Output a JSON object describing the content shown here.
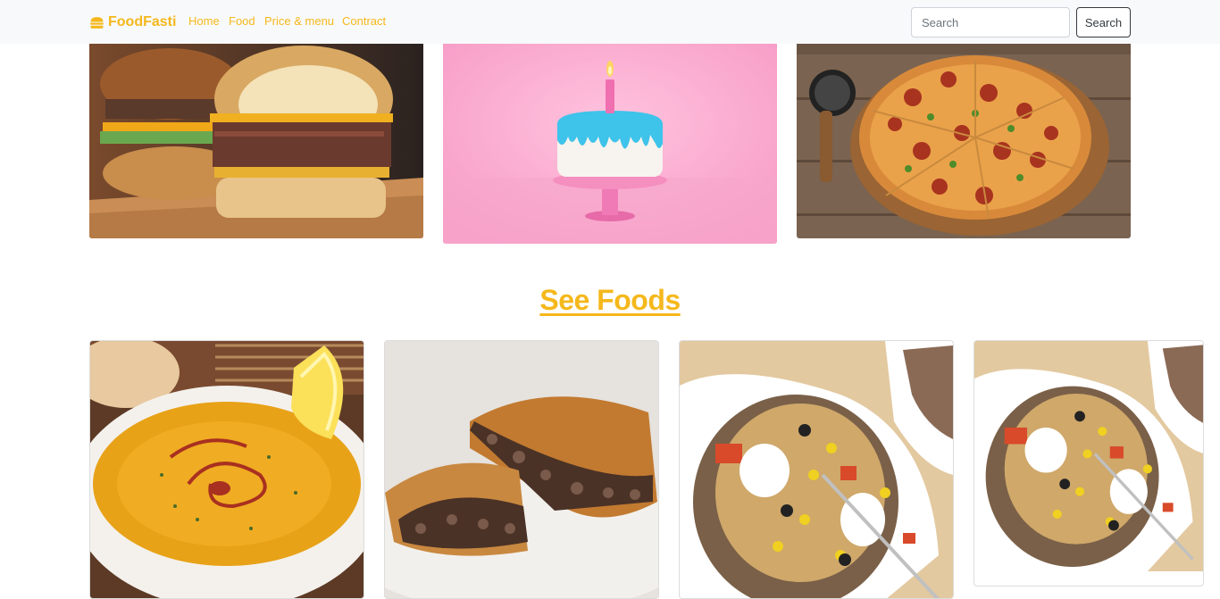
{
  "brand": {
    "name": "FoodFasti",
    "icon": "burger-icon"
  },
  "nav": {
    "links": [
      {
        "label": "Home"
      },
      {
        "label": "Food"
      },
      {
        "label": "Price & menu"
      },
      {
        "label": "Contract"
      }
    ]
  },
  "search": {
    "placeholder": "Search",
    "button_label": "Search"
  },
  "hero": [
    {
      "image": "burger-photo"
    },
    {
      "image": "birthday-cake-photo"
    },
    {
      "image": "pizza-photo"
    }
  ],
  "section": {
    "title": "See Foods"
  },
  "food_cards": [
    {
      "image": "lentil-soup-photo"
    },
    {
      "image": "meat-pie-photo"
    },
    {
      "image": "stuffed-potato-photo"
    },
    {
      "image": "stuffed-potato-photo"
    }
  ],
  "colors": {
    "accent": "#f5b81c",
    "navbar_bg": "#f8f9fa",
    "button_border": "#343a40"
  }
}
